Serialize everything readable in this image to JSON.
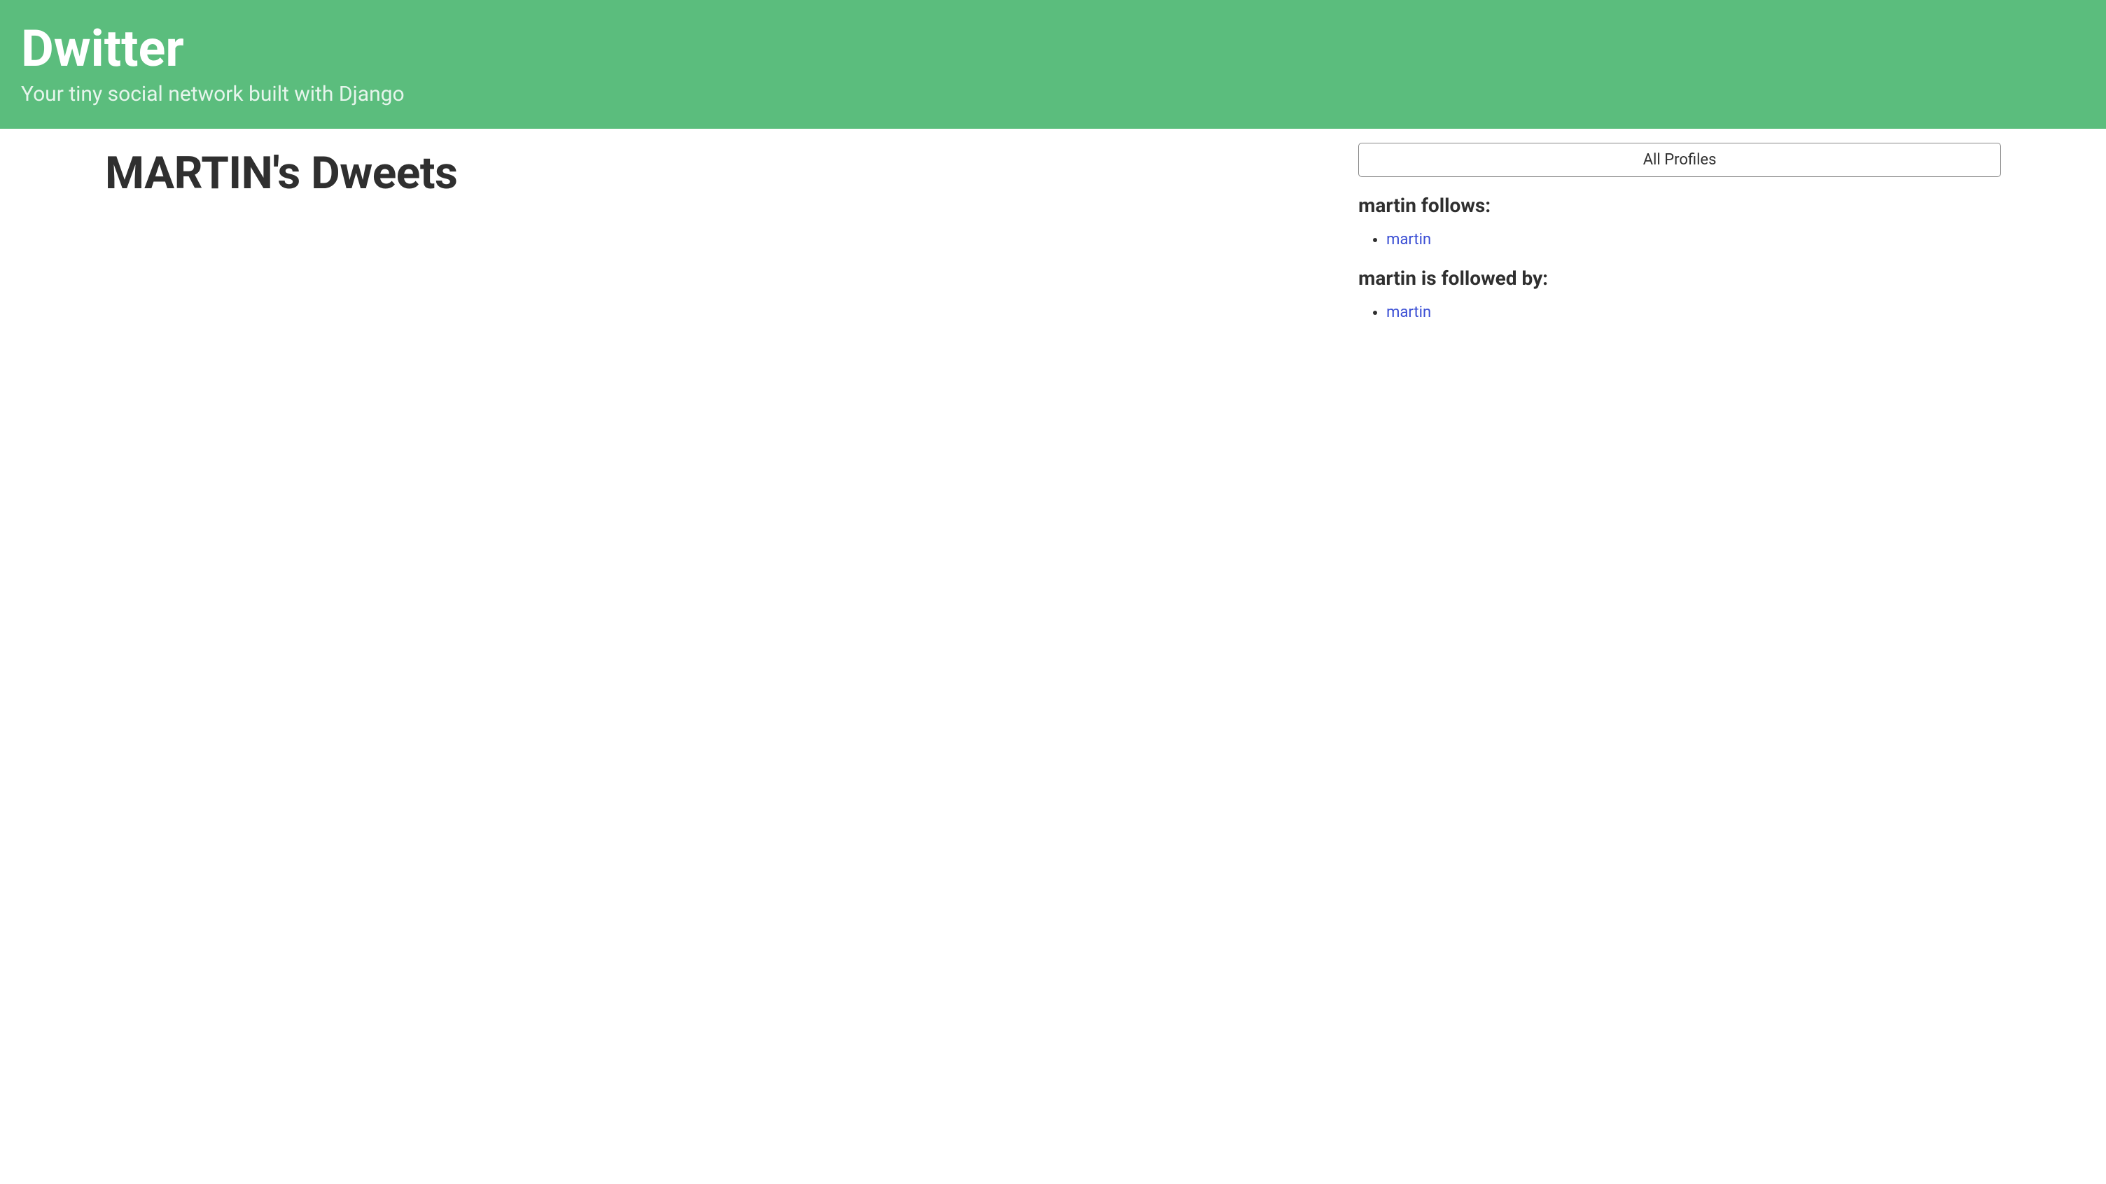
{
  "header": {
    "title": "Dwitter",
    "subtitle": "Your tiny social network built with Django"
  },
  "main": {
    "page_title": "MARTIN's Dweets"
  },
  "sidebar": {
    "all_profiles_label": "All Profiles",
    "follows_heading": "martin follows:",
    "follows_list": [
      {
        "label": "martin"
      }
    ],
    "followed_by_heading": "martin is followed by:",
    "followed_by_list": [
      {
        "label": "martin"
      }
    ]
  }
}
